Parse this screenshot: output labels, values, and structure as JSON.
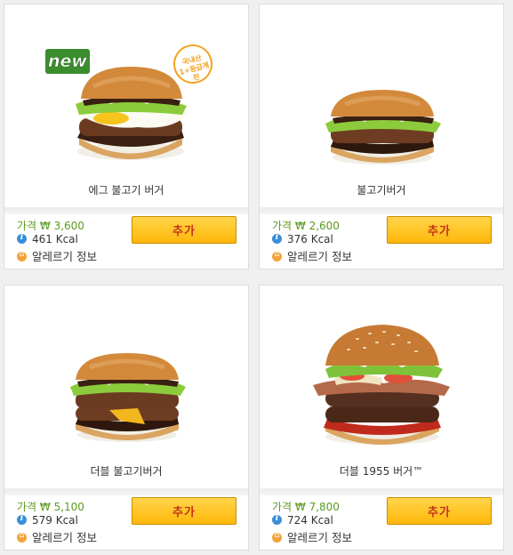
{
  "products": [
    {
      "name": "에그 불고기 버거",
      "price": "가격 ₩ 3,600",
      "kcal": "461 Kcal",
      "allergy_label": "알레르기 정보",
      "add_label": "추가",
      "badge_new": "new",
      "badge_stamp": "국내산 1+등급계란",
      "variant": "egg"
    },
    {
      "name": "불고기버거",
      "price": "가격 ₩ 2,600",
      "kcal": "376 Kcal",
      "allergy_label": "알레르기 정보",
      "add_label": "추가",
      "variant": "single"
    },
    {
      "name": "더블 불고기버거",
      "price": "가격 ₩ 5,100",
      "kcal": "579 Kcal",
      "allergy_label": "알레르기 정보",
      "add_label": "추가",
      "variant": "double"
    },
    {
      "name": "더블 1955 버거™",
      "price": "가격 ₩ 7,800",
      "kcal": "724 Kcal",
      "allergy_label": "알레르기 정보",
      "add_label": "추가",
      "variant": "1955"
    }
  ],
  "colors": {
    "price_green": "#5b9a1e",
    "button_yellow": "#ffc524",
    "button_text_red": "#c4311c",
    "info_blue": "#3a8fd9",
    "allergy_orange": "#f2a33a"
  }
}
